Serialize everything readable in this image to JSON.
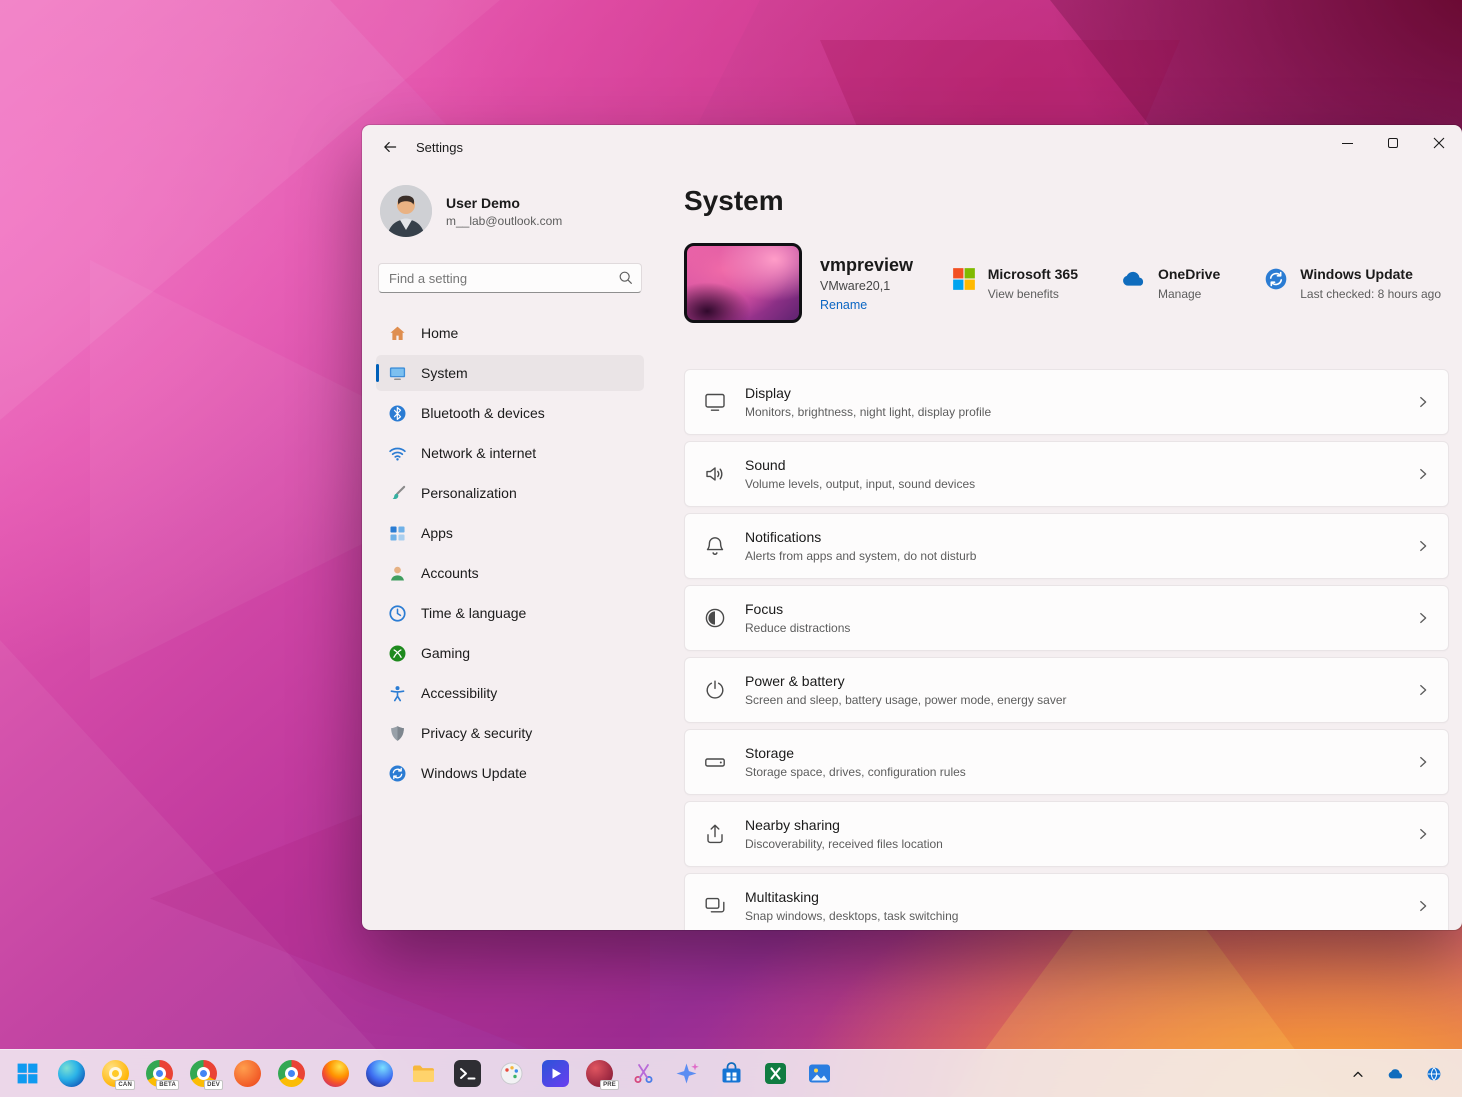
{
  "window": {
    "title": "Settings"
  },
  "user": {
    "name": "User Demo",
    "email": "m__lab@outlook.com"
  },
  "search": {
    "placeholder": "Find a setting"
  },
  "colors": {
    "accent": "#005fb8",
    "link": "#0b66c3",
    "selected_pill": "#eae4e6",
    "window_bg": "#f5eff1"
  },
  "sidebar": {
    "items": [
      {
        "label": "Home",
        "icon": "home-icon"
      },
      {
        "label": "System",
        "icon": "system-icon",
        "selected": true
      },
      {
        "label": "Bluetooth & devices",
        "icon": "bluetooth-icon"
      },
      {
        "label": "Network & internet",
        "icon": "network-icon"
      },
      {
        "label": "Personalization",
        "icon": "personalization-icon"
      },
      {
        "label": "Apps",
        "icon": "apps-icon"
      },
      {
        "label": "Accounts",
        "icon": "accounts-icon"
      },
      {
        "label": "Time & language",
        "icon": "time-language-icon"
      },
      {
        "label": "Gaming",
        "icon": "gaming-icon"
      },
      {
        "label": "Accessibility",
        "icon": "accessibility-icon"
      },
      {
        "label": "Privacy & security",
        "icon": "privacy-security-icon"
      },
      {
        "label": "Windows Update",
        "icon": "windows-update-icon"
      }
    ]
  },
  "main": {
    "title": "System",
    "device": {
      "name": "vmpreview",
      "model": "VMware20,1",
      "rename_label": "Rename"
    },
    "status_cards": [
      {
        "title": "Microsoft 365",
        "subtitle": "View benefits",
        "icon": "microsoft-365-icon"
      },
      {
        "title": "OneDrive",
        "subtitle": "Manage",
        "icon": "onedrive-icon"
      },
      {
        "title": "Windows Update",
        "subtitle": "Last checked: 8 hours ago",
        "icon": "windows-update-icon"
      }
    ],
    "settings": [
      {
        "label": "Display",
        "desc": "Monitors, brightness, night light, display profile",
        "icon": "display-icon"
      },
      {
        "label": "Sound",
        "desc": "Volume levels, output, input, sound devices",
        "icon": "sound-icon"
      },
      {
        "label": "Notifications",
        "desc": "Alerts from apps and system, do not disturb",
        "icon": "notifications-icon"
      },
      {
        "label": "Focus",
        "desc": "Reduce distractions",
        "icon": "focus-icon"
      },
      {
        "label": "Power & battery",
        "desc": "Screen and sleep, battery usage, power mode, energy saver",
        "icon": "power-icon"
      },
      {
        "label": "Storage",
        "desc": "Storage space, drives, configuration rules",
        "icon": "storage-icon"
      },
      {
        "label": "Nearby sharing",
        "desc": "Discoverability, received files location",
        "icon": "nearby-sharing-icon"
      },
      {
        "label": "Multitasking",
        "desc": "Snap windows, desktops, task switching",
        "icon": "multitasking-icon"
      }
    ]
  },
  "taskbar": {
    "icons": [
      "start",
      "edge",
      "chrome-canary",
      "chrome-beta",
      "chrome-dev",
      "brave",
      "chrome",
      "firefox",
      "firefox-nightly",
      "file-explorer",
      "terminal",
      "paint",
      "movies-tv",
      "preview-app",
      "snipping-tool",
      "copilot",
      "microsoft-store",
      "excel",
      "photos"
    ],
    "badges": {
      "canary": "CAN",
      "beta": "BETA",
      "dev": "DEV",
      "pre": "PRE"
    },
    "tray": [
      "hidden-icons-chevron",
      "onedrive",
      "network"
    ]
  }
}
